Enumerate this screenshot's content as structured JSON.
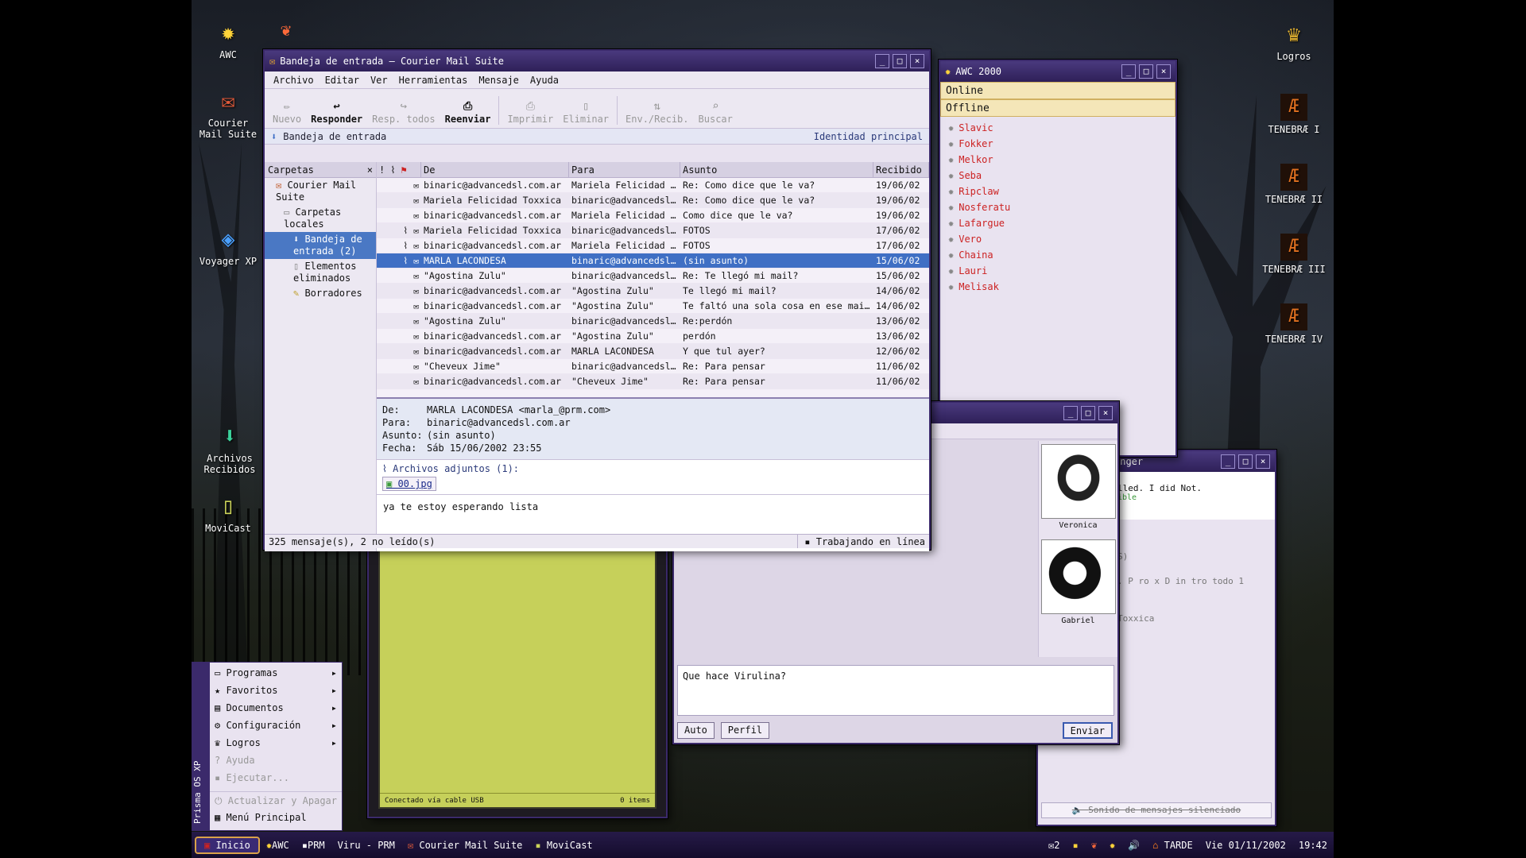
{
  "desktop": {
    "icons": [
      {
        "label": "AWC",
        "icon": "sun-icon"
      },
      {
        "label": "Courier Mail Suite",
        "icon": "mail-icon"
      },
      {
        "label": "Voyager XP",
        "icon": "globe-icon"
      },
      {
        "label": "Archivos Recibidos",
        "icon": "download-icon"
      },
      {
        "label": "MoviCast",
        "icon": "phone-icon"
      },
      {
        "label": "Logros",
        "icon": "trophy-icon"
      },
      {
        "label": "TENEBRÆ I",
        "icon": "game-icon"
      },
      {
        "label": "TENEBRÆ II",
        "icon": "game-icon"
      },
      {
        "label": "TENEBRÆ III",
        "icon": "game-icon"
      },
      {
        "label": "TENEBRÆ IV",
        "icon": "game-icon"
      }
    ]
  },
  "mail": {
    "title": "Bandeja de entrada – Courier Mail Suite",
    "menu": [
      "Archivo",
      "Editar",
      "Ver",
      "Herramientas",
      "Mensaje",
      "Ayuda"
    ],
    "toolbar": [
      {
        "label": "Nuevo",
        "on": false
      },
      {
        "label": "Responder",
        "on": true
      },
      {
        "label": "Resp. todos",
        "on": false
      },
      {
        "label": "Reenviar",
        "on": true
      },
      {
        "label": "Imprimir",
        "on": false
      },
      {
        "label": "Eliminar",
        "on": false
      },
      {
        "label": "Env./Recib.",
        "on": false
      },
      {
        "label": "Buscar",
        "on": false
      }
    ],
    "crumb": "Bandeja de entrada",
    "identity": "Identidad principal",
    "folders_title": "Carpetas",
    "folders": [
      "Courier Mail Suite",
      "Carpetas locales",
      "Bandeja de entrada (2)",
      "Elementos eliminados",
      "Borradores"
    ],
    "columns": [
      "De",
      "Para",
      "Asunto",
      "Recibido"
    ],
    "rows": [
      [
        "binaric@advancedsl.com.ar",
        "Mariela Felicidad T…",
        "Re: Como dice que le va?",
        "19/06/02"
      ],
      [
        "Mariela Felicidad Toxxica",
        "binaric@advancedsl…",
        "Re: Como dice que le va?",
        "19/06/02"
      ],
      [
        "binaric@advancedsl.com.ar",
        "Mariela Felicidad T…",
        "Como dice que le va?",
        "19/06/02"
      ],
      [
        "Mariela Felicidad Toxxica",
        "binaric@advancedsl…",
        "FOTOS",
        "17/06/02"
      ],
      [
        "binaric@advancedsl.com.ar",
        "Mariela Felicidad T…",
        "FOTOS",
        "17/06/02"
      ],
      [
        "MARLA LACONDESA",
        "binaric@advancedsl…",
        "(sin asunto)",
        "15/06/02"
      ],
      [
        "\"Agostina Zulu\"",
        "binaric@advancedsl…",
        "Re: Te llegó mi mail?",
        "15/06/02"
      ],
      [
        "binaric@advancedsl.com.ar",
        "\"Agostina Zulu\"",
        "Te llegó mi mail?",
        "14/06/02"
      ],
      [
        "binaric@advancedsl.com.ar",
        "\"Agostina Zulu\"",
        "Te faltó una sola cosa en ese mail…",
        "14/06/02"
      ],
      [
        "\"Agostina Zulu\"",
        "binaric@advancedsl…",
        "Re:perdón",
        "13/06/02"
      ],
      [
        "binaric@advancedsl.com.ar",
        "\"Agostina Zulu\"",
        "perdón",
        "13/06/02"
      ],
      [
        "binaric@advancedsl.com.ar",
        "MARLA LACONDESA",
        "Y que tul ayer?",
        "12/06/02"
      ],
      [
        "\"Cheveux Jime\"",
        "binaric@advancedsl…",
        "Re: Para pensar",
        "11/06/02"
      ],
      [
        "binaric@advancedsl.com.ar",
        "\"Cheveux Jime\"",
        "Re: Para pensar",
        "11/06/02"
      ]
    ],
    "preview": {
      "from_l": "De:",
      "from": "MARLA LACONDESA <marla_@prm.com>",
      "to_l": "Para:",
      "to": "binaric@advancedsl.com.ar",
      "subj_l": "Asunto:",
      "subj": "(sin asunto)",
      "date_l": "Fecha:",
      "date": "Sáb 15/06/2002 23:55",
      "att_title": "Archivos adjuntos (1):",
      "att": "00.jpg",
      "body": "ya te estoy esperando lista"
    },
    "status": "325 mensaje(s), 2 no leído(s)",
    "online": "Trabajando en línea"
  },
  "awc": {
    "title": "AWC 2000",
    "online": "Online",
    "offline": "Offline",
    "contacts": [
      "Slavic",
      "Fokker",
      "Melkor",
      "Seba",
      "Ripclaw",
      "Nosferatu",
      "Lafargue",
      "Vero",
      "Chaina",
      "Lauri",
      "Melisak"
    ]
  },
  "chat": {
    "persons": [
      "Veronica",
      "Gabriel"
    ],
    "input": "Que hace Virulina?",
    "auto": "Auto",
    "perfil": "Perfil",
    "send": "Enviar"
  },
  "messenger": {
    "title": "enger",
    "line1": "lled. I did Not.",
    "line2": "ible",
    "line3": "S)",
    "line4": ". P ro x D in tro todo 1",
    "line5": "Toxxica",
    "mute": "Sonido de mensajes silenciado"
  },
  "movicast": {
    "status": "Conectado vía cable USB",
    "items": "0 items"
  },
  "start": {
    "side": "Prisma OS XP",
    "items": [
      {
        "label": "Programas",
        "arrow": "▸",
        "dis": false
      },
      {
        "label": "Favoritos",
        "arrow": "▸",
        "dis": false
      },
      {
        "label": "Documentos",
        "arrow": "▸",
        "dis": false
      },
      {
        "label": "Configuración",
        "arrow": "▸",
        "dis": false
      },
      {
        "label": "Logros",
        "arrow": "▸",
        "dis": false
      },
      {
        "label": "Ayuda",
        "arrow": "",
        "dis": true
      },
      {
        "label": "Ejecutar...",
        "arrow": "",
        "dis": true
      },
      {
        "label": "Actualizar y Apagar",
        "arrow": "",
        "dis": true
      },
      {
        "label": "Menú Principal",
        "arrow": "",
        "dis": false
      }
    ]
  },
  "taskbar": {
    "start": "Inicio",
    "tasks": [
      "AWC",
      "PRM",
      "Viru - PRM",
      "Courier Mail Suite",
      "MoviCast"
    ],
    "mail_count": "✉2",
    "period": "TARDE",
    "date": "Vie 01/11/2002",
    "time": "19:42"
  }
}
